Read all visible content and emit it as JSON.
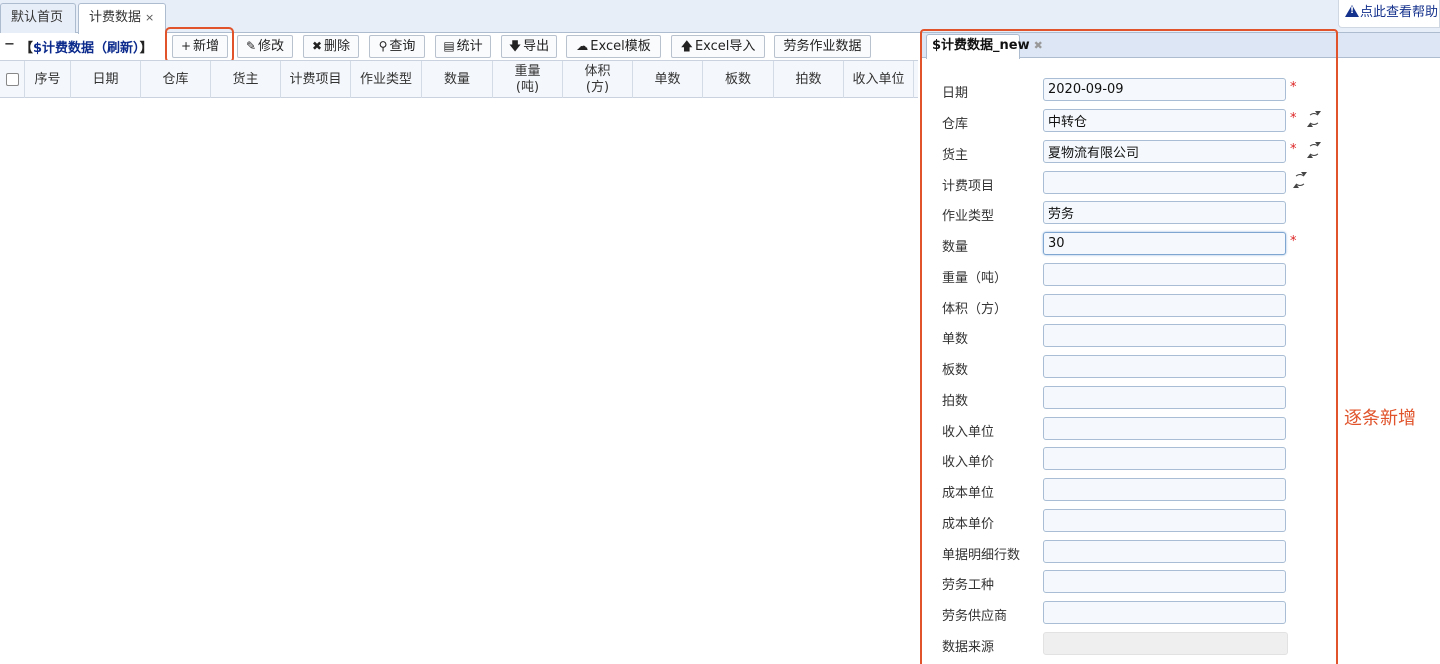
{
  "tabs": [
    {
      "label": "默认首页"
    },
    {
      "label": "计费数据",
      "close": "×"
    }
  ],
  "help": {
    "label": "点此查看帮助"
  },
  "toolbar": {
    "collapse": "−",
    "bracket_open": "【",
    "title": "$计费数据（刷新）",
    "bracket_close": "】",
    "buttons": {
      "add": "新增",
      "edit": "修改",
      "delete": "删除",
      "query": "查询",
      "stats": "统计",
      "export": "导出",
      "excel_template": "Excel模板",
      "excel_import": "Excel导入",
      "labor_data": "劳务作业数据"
    }
  },
  "grid": {
    "columns": [
      "序号",
      "日期",
      "仓库",
      "货主",
      "计费项目",
      "作业类型",
      "数量",
      "重量\n(吨)",
      "体积\n(方)",
      "单数",
      "板数",
      "拍数",
      "收入单位"
    ]
  },
  "panel": {
    "tab_label": "$计费数据_new",
    "tab_close": "✖",
    "fields": [
      {
        "label": "日期",
        "value": "2020-09-09"
      },
      {
        "label": "仓库",
        "value": "中转仓"
      },
      {
        "label": "货主",
        "value": "夏物流有限公司"
      },
      {
        "label": "计费项目",
        "value": ""
      },
      {
        "label": "作业类型",
        "value": "劳务"
      },
      {
        "label": "数量",
        "value": "30"
      },
      {
        "label": "重量（吨）",
        "value": ""
      },
      {
        "label": "体积（方）",
        "value": ""
      },
      {
        "label": "单数",
        "value": ""
      },
      {
        "label": "板数",
        "value": ""
      },
      {
        "label": "拍数",
        "value": ""
      },
      {
        "label": "收入单位",
        "value": ""
      },
      {
        "label": "收入单价",
        "value": ""
      },
      {
        "label": "成本单位",
        "value": ""
      },
      {
        "label": "成本单价",
        "value": ""
      },
      {
        "label": "单据明细行数",
        "value": ""
      },
      {
        "label": "劳务工种",
        "value": ""
      },
      {
        "label": "劳务供应商",
        "value": ""
      },
      {
        "label": "数据来源",
        "value": ""
      }
    ],
    "required_mark": "*"
  },
  "annotation": "逐条新增",
  "colors": {
    "accent_red": "#e0532b",
    "link_blue": "#0b2a8c"
  }
}
